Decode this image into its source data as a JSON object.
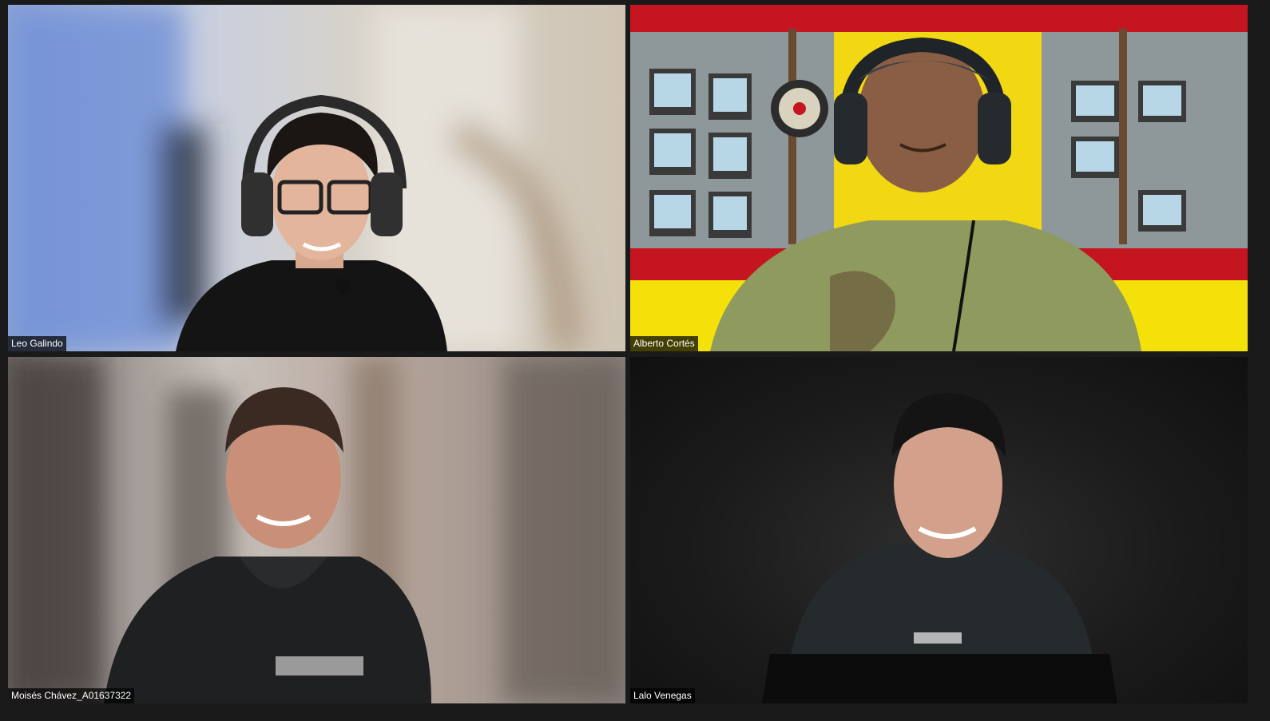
{
  "participants": [
    {
      "name": "Leo Galindo"
    },
    {
      "name": "Alberto Cortés"
    },
    {
      "name": "Moisés Chávez_A01637322"
    },
    {
      "name": "Lalo Venegas"
    }
  ],
  "colors": {
    "window_bg": "#1a1a1a",
    "label_bg": "#000000",
    "label_text": "#ffffff"
  }
}
